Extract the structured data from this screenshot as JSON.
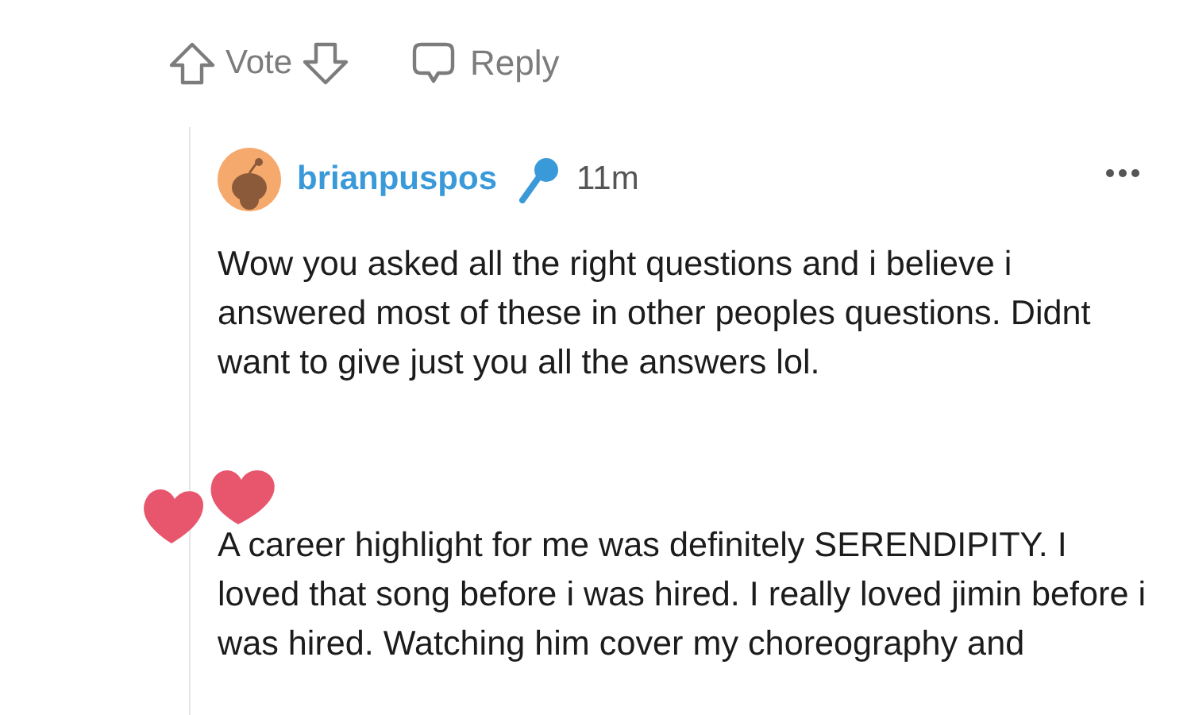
{
  "actions": {
    "vote_label": "Vote",
    "reply_label": "Reply"
  },
  "comment": {
    "author": "brianpuspos",
    "time": "11m",
    "paragraphs": [
      "Wow you asked all the right questions and i believe i answered most of these in other peoples questions. Didnt want to give just you all the answers lol.",
      "A career highlight for me was definitely SERENDIPITY. I loved that song before i was hired. I really loved jimin before i was hired. Watching him cover my choreography and"
    ]
  }
}
